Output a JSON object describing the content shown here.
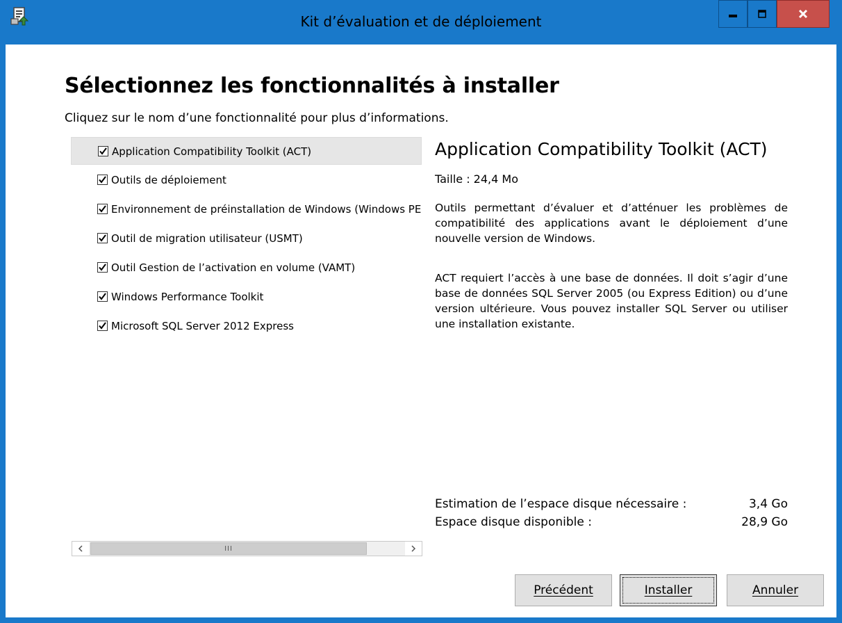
{
  "window": {
    "title": "Kit d’évaluation et de déploiement",
    "controls": {
      "minimize": "minimize-icon",
      "maximize": "maximize-icon",
      "close": "close-icon"
    },
    "accent_color": "#1979ca",
    "close_color": "#c7504b"
  },
  "page": {
    "heading": "Sélectionnez les fonctionnalités à installer",
    "subtitle": "Cliquez sur le nom d’une fonctionnalité pour plus d’informations."
  },
  "features": [
    {
      "label": "Application Compatibility Toolkit (ACT)",
      "checked": true,
      "selected": true
    },
    {
      "label": "Outils de déploiement",
      "checked": true,
      "selected": false
    },
    {
      "label": "Environnement de préinstallation de Windows (Windows PE)",
      "checked": true,
      "selected": false
    },
    {
      "label": "Outil de migration utilisateur (USMT)",
      "checked": true,
      "selected": false
    },
    {
      "label": "Outil Gestion de l’activation en volume (VAMT)",
      "checked": true,
      "selected": false
    },
    {
      "label": "Windows Performance Toolkit",
      "checked": true,
      "selected": false
    },
    {
      "label": "Microsoft SQL Server 2012 Express",
      "checked": true,
      "selected": false
    }
  ],
  "detail": {
    "title": "Application Compatibility Toolkit (ACT)",
    "size": "Taille : 24,4 Mo",
    "description": "Outils permettant d’évaluer et d’atténuer les problèmes de compatibilité des applications avant le déploiement d’une nouvelle version de Windows.",
    "description2": "ACT requiert l’accès à une base de données. Il doit s’agir d’une base de données SQL Server 2005 (ou Express Edition) ou d’une version ultérieure. Vous pouvez installer SQL Server ou utiliser une installation existante."
  },
  "disk": {
    "required_label": "Estimation de l’espace disque nécessaire :",
    "required_value": "3,4 Go",
    "available_label": "Espace disque disponible :",
    "available_value": "28,9 Go"
  },
  "scrollbar": {
    "left_icon": "chevron-left-icon",
    "right_icon": "chevron-right-icon",
    "grip": "III"
  },
  "buttons": {
    "back": "Précédent",
    "install": "Installer",
    "cancel": "Annuler"
  }
}
